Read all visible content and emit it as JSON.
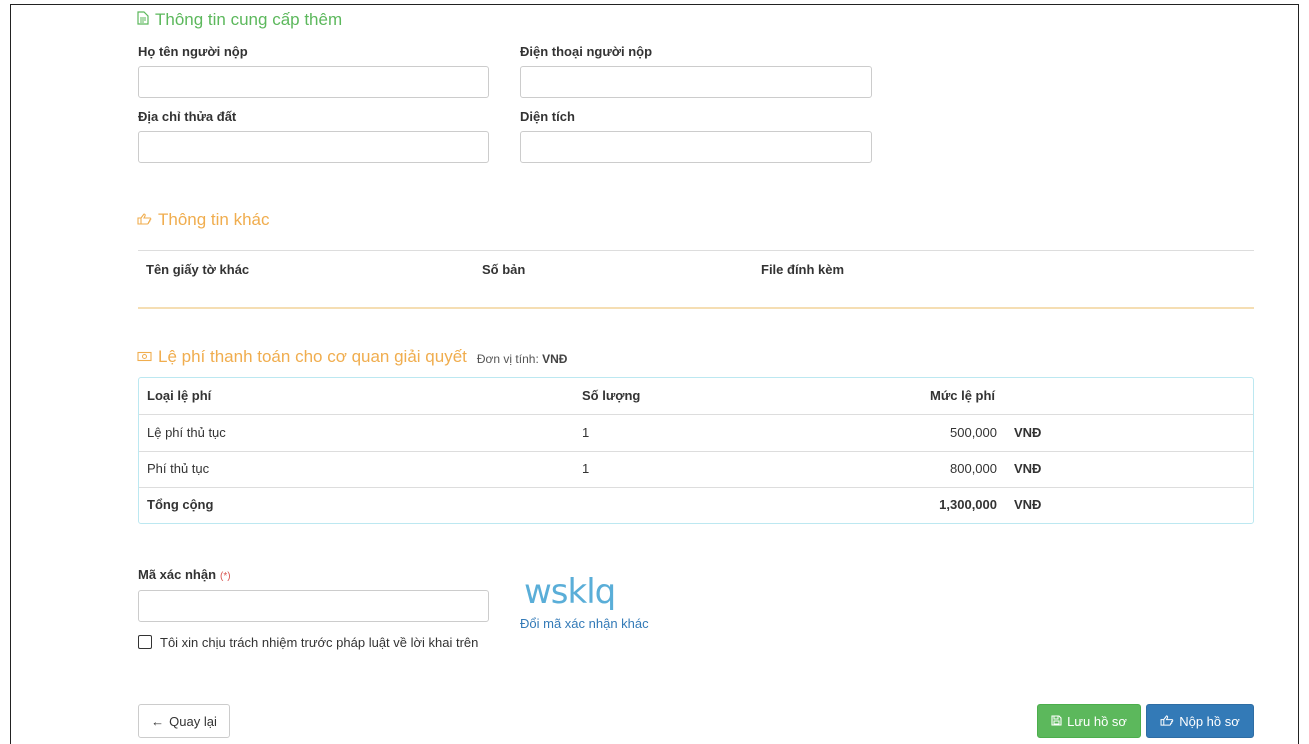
{
  "extra_info": {
    "title": "Thông tin cung cấp thêm",
    "fields": {
      "submitter_name_label": "Họ tên người nộp",
      "submitter_phone_label": "Điện thoại người nộp",
      "land_address_label": "Địa chỉ thửa đất",
      "area_label": "Diện tích"
    },
    "values": {
      "submitter_name": "",
      "submitter_phone": "",
      "land_address": "",
      "area": ""
    }
  },
  "other_info": {
    "title": "Thông tin khác",
    "columns": [
      "Tên giấy tờ khác",
      "Số bản",
      "File đính kèm"
    ]
  },
  "fees": {
    "title": "Lệ phí thanh toán cho cơ quan giải quyết",
    "unit_label": "Đơn vị tính:",
    "unit_value": "VNĐ",
    "columns": [
      "Loại lệ phí",
      "Số lượng",
      "Mức lệ phí"
    ],
    "rows": [
      {
        "type": "Lệ phí thủ tục",
        "qty": "1",
        "amount": "500,000",
        "currency": "VNĐ"
      },
      {
        "type": "Phí thủ tục",
        "qty": "1",
        "amount": "800,000",
        "currency": "VNĐ"
      }
    ],
    "total": {
      "label": "Tổng cộng",
      "amount": "1,300,000",
      "currency": "VNĐ"
    }
  },
  "captcha": {
    "label": "Mã xác nhận",
    "required_mark": "(*)",
    "image_text": "wsklq",
    "refresh_link": "Đổi mã xác nhận khác",
    "value": ""
  },
  "agreement": {
    "label": "Tôi xin chịu trách nhiệm trước pháp luật về lời khai trên",
    "checked": false
  },
  "actions": {
    "back_label": "Quay lại",
    "save_label": "Lưu hồ sơ",
    "submit_label": "Nộp hồ sơ"
  },
  "icons": {
    "extra_info": "document-icon",
    "other_info": "hand-point-right-icon",
    "fees": "money-icon",
    "back": "arrow-left-icon",
    "save": "floppy-disk-icon",
    "submit": "hand-point-right-icon"
  },
  "colors": {
    "green": "#5cb85c",
    "orange": "#f0ad4e",
    "blue": "#337ab7",
    "table_border": "#bce8f1"
  }
}
